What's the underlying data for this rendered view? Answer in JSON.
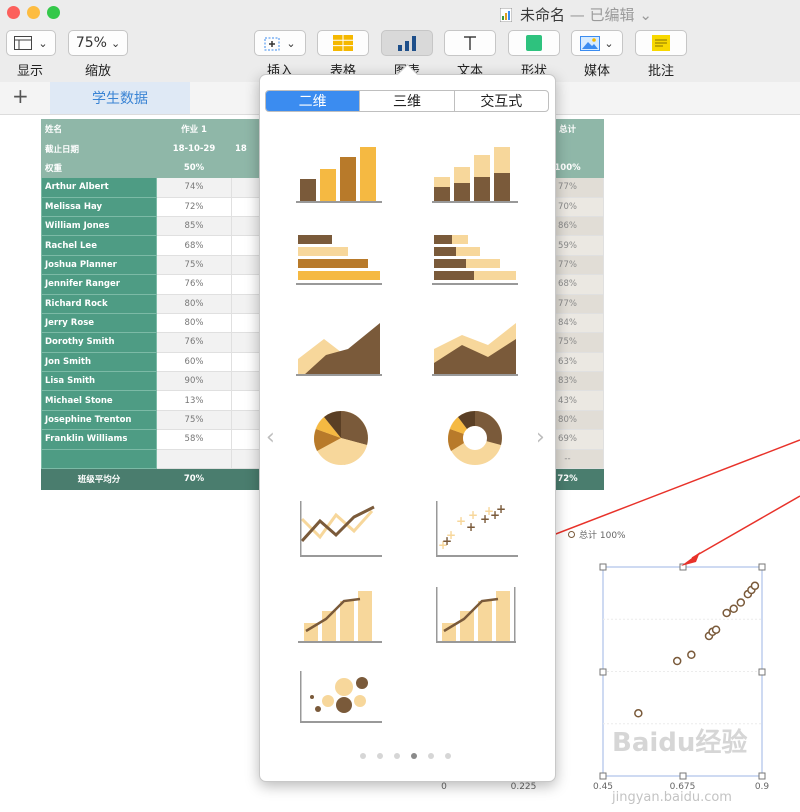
{
  "window": {
    "title": "未命名",
    "subtitle": " — 已编辑"
  },
  "toolbar": {
    "view_label": "显示",
    "zoom_value": "75%",
    "zoom_label": "缩放",
    "insert_label": "插入",
    "table_label": "表格",
    "chart_label": "图表",
    "text_label": "文本",
    "shape_label": "形状",
    "media_label": "媒体",
    "comment_label": "批注"
  },
  "sheet": {
    "tab_name": "学生数据",
    "add_symbol": "+"
  },
  "table": {
    "headers": [
      [
        "姓名",
        "作业 1",
        "",
        "总计"
      ],
      [
        "截止日期",
        "18-10-29",
        "18",
        ""
      ],
      [
        "权重",
        "50%",
        "",
        "100%"
      ]
    ],
    "rows": [
      {
        "name": "Arthur Albert",
        "hw1": "74%",
        "total": "77%"
      },
      {
        "name": "Melissa Hay",
        "hw1": "72%",
        "total": "70%"
      },
      {
        "name": "William Jones",
        "hw1": "85%",
        "total": "86%"
      },
      {
        "name": "Rachel Lee",
        "hw1": "68%",
        "total": "59%"
      },
      {
        "name": "Joshua Planner",
        "hw1": "75%",
        "total": "77%"
      },
      {
        "name": "Jennifer Ranger",
        "hw1": "76%",
        "total": "68%"
      },
      {
        "name": "Richard Rock",
        "hw1": "80%",
        "total": "77%"
      },
      {
        "name": "Jerry Rose",
        "hw1": "80%",
        "total": "84%"
      },
      {
        "name": "Dorothy Smith",
        "hw1": "76%",
        "total": "75%"
      },
      {
        "name": "Jon Smith",
        "hw1": "60%",
        "total": "63%"
      },
      {
        "name": "Lisa Smith",
        "hw1": "90%",
        "total": "83%"
      },
      {
        "name": "Michael Stone",
        "hw1": "13%",
        "total": "43%"
      },
      {
        "name": "Josephine Trenton",
        "hw1": "75%",
        "total": "80%"
      },
      {
        "name": "Franklin Williams",
        "hw1": "58%",
        "total": "69%"
      },
      {
        "name": "",
        "hw1": "",
        "total": "--"
      }
    ],
    "footer": {
      "label": "班级平均分",
      "hw1": "70%",
      "total": "72%"
    }
  },
  "chart_picker": {
    "tabs": [
      "二维",
      "三维",
      "交互式"
    ],
    "selected_tab": 0,
    "charts": [
      "column-chart",
      "stacked-column-chart",
      "bar-chart",
      "stacked-bar-chart",
      "area-chart",
      "stacked-area-chart",
      "pie-chart",
      "donut-chart",
      "line-chart",
      "scatter-chart",
      "mixed-chart",
      "two-axis-chart",
      "bubble-chart"
    ],
    "page_count": 6,
    "current_page": 3
  },
  "chart_data": {
    "type": "scatter",
    "legend": [
      "总计 100%"
    ],
    "x_ticks": [
      "0",
      "0.225",
      "0.45",
      "0.675",
      "0.9"
    ],
    "xlim": [
      0,
      0.9
    ],
    "points": [
      [
        0.55,
        0.3
      ],
      [
        0.66,
        0.55
      ],
      [
        0.7,
        0.58
      ],
      [
        0.75,
        0.67
      ],
      [
        0.76,
        0.69
      ],
      [
        0.77,
        0.7
      ],
      [
        0.8,
        0.78
      ],
      [
        0.82,
        0.8
      ],
      [
        0.84,
        0.83
      ],
      [
        0.86,
        0.87
      ],
      [
        0.87,
        0.89
      ],
      [
        0.88,
        0.91
      ]
    ]
  },
  "colors": {
    "accent": "#3b8cf0",
    "table_header": "#8fb7a8",
    "table_name": "#4e9c84",
    "table_footer": "#4a7d6e",
    "chart_dark": "#7a5a3a",
    "chart_light": "#f7d79b",
    "chart_mid": "#b87a2a",
    "chart_gold": "#f5b942",
    "arrow": "#e8322a"
  },
  "watermark": {
    "text": "Baidu经验",
    "url": "jingyan.baidu.com"
  }
}
